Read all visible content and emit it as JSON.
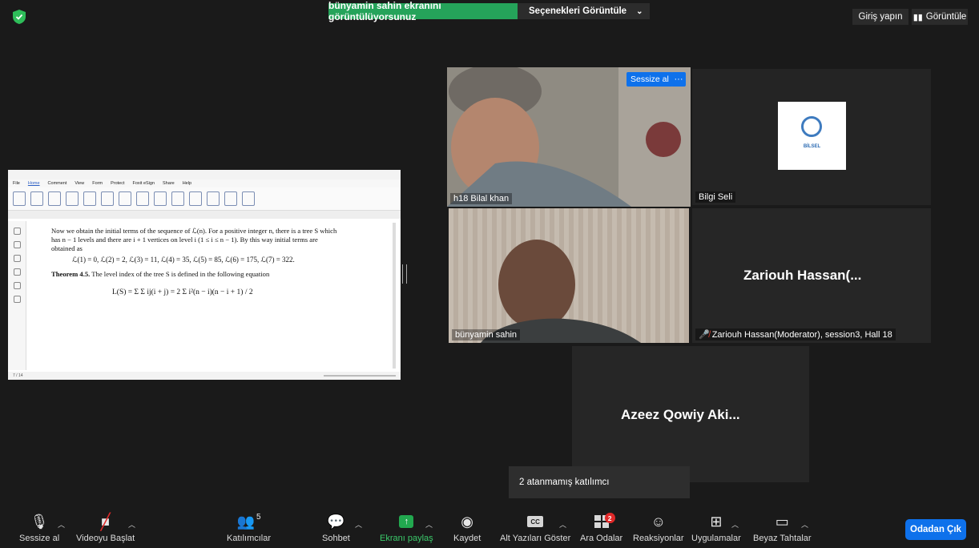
{
  "top_bar": {
    "share_banner": "bünyamin sahin ekranını görüntülüyorsunuz",
    "view_options": "Seçenekleri Görüntüle",
    "sign_in": "Giriş yapın",
    "view": "Görüntüle"
  },
  "shared_screen": {
    "menu": [
      "File",
      "Home",
      "Comment",
      "View",
      "Form",
      "Protect",
      "Foxit eSign",
      "Share",
      "Help"
    ],
    "paragraph": "Now we obtain the initial terms of the sequence of ℒ(n). For a positive integer n, there is a tree S which has n − 1 levels and there are i + 1 vertices on level i (1 ≤ i ≤ n − 1). By this way initial terms are obtained as",
    "equation_1": "ℒ(1) = 0, ℒ(2) = 2, ℒ(3) = 11, ℒ(4) = 35, ℒ(5) = 85, ℒ(6) = 175, ℒ(7) = 322.",
    "theorem_label": "Theorem 4.5.",
    "theorem_text": "The level index of the tree S is defined in the following equation",
    "equation_2": "L(S) = Σ Σ ij(i + j) = 2 Σ i²(n − i)(n − i + 1) / 2",
    "page_indicator": "7 / 14"
  },
  "tiles": {
    "tile1": {
      "name": "h18 Bilal khan",
      "mute_label": "Sessize al",
      "more": "···"
    },
    "tile2": {
      "name": "Bilgi Seli",
      "logo_text": "BİLSEL"
    },
    "tile3": {
      "name": "bünyamin sahin"
    },
    "tile4": {
      "big_name": "Zariouh  Hassan(...",
      "name": "Zariouh Hassan(Moderator), session3, Hall 18"
    },
    "tile5": {
      "big_name": "Azeez Qowiy Aki..."
    }
  },
  "toast": "2 atanmamış katılımcı",
  "toolbar": {
    "mute": "Sessize al",
    "video": "Videoyu Başlat",
    "participants": "Katılımcılar",
    "participants_count": "5",
    "chat": "Sohbet",
    "share": "Ekranı paylaş",
    "record": "Kaydet",
    "captions": "Alt Yazıları Göster",
    "cc": "CC",
    "breakout": "Ara Odalar",
    "breakout_badge": "2",
    "reactions": "Reaksiyonlar",
    "apps": "Uygulamalar",
    "whiteboard": "Beyaz Tahtalar",
    "leave": "Odadan Çık"
  },
  "colors": {
    "accent_blue": "#0e71eb",
    "share_green": "#25a35a",
    "active_speaker": "#e4ea6a"
  }
}
